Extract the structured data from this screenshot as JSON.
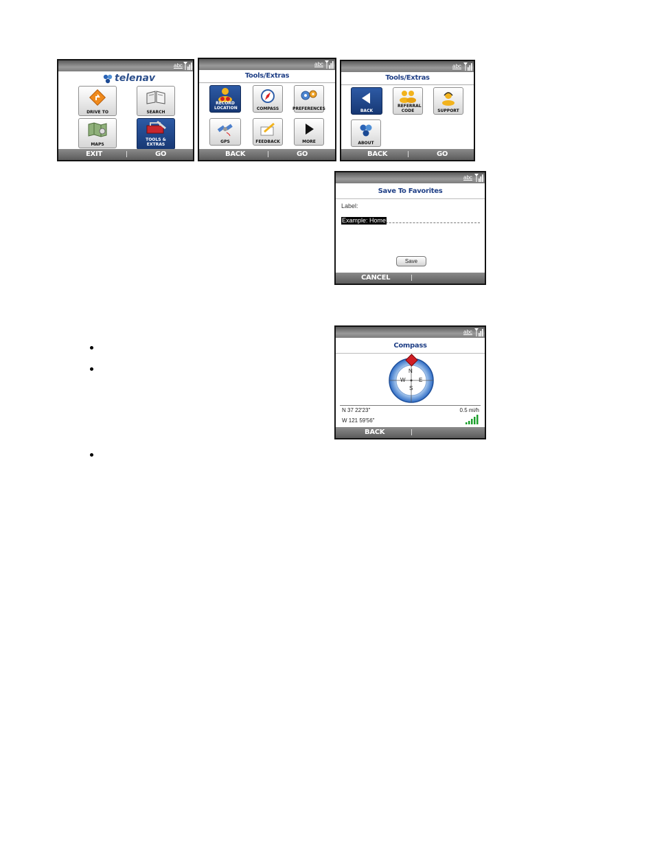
{
  "status": {
    "abc_label": "abc"
  },
  "screen_main": {
    "logo_text": "telenav",
    "items": [
      {
        "label": "DRIVE TO"
      },
      {
        "label": "SEARCH"
      },
      {
        "label": "MAPS"
      },
      {
        "label": "TOOLS & EXTRAS"
      }
    ],
    "left_soft": "EXIT",
    "right_soft": "GO"
  },
  "screen_tools1": {
    "title": "Tools/Extras",
    "items": [
      {
        "label": "RECORD LOCATION"
      },
      {
        "label": "COMPASS"
      },
      {
        "label": "PREFERENCES"
      },
      {
        "label": "GPS"
      },
      {
        "label": "FEEDBACK"
      },
      {
        "label": "MORE"
      }
    ],
    "left_soft": "BACK",
    "right_soft": "GO"
  },
  "screen_tools2": {
    "title": "Tools/Extras",
    "items": [
      {
        "label": "BACK"
      },
      {
        "label": "REFERRAL CODE"
      },
      {
        "label": "SUPPORT"
      },
      {
        "label": "ABOUT"
      }
    ],
    "left_soft": "BACK",
    "right_soft": "GO"
  },
  "screen_favorites": {
    "title": "Save To Favorites",
    "field_label": "Label:",
    "field_value": "Example: Home",
    "save_button": "Save",
    "left_soft": "CANCEL"
  },
  "screen_compass": {
    "title": "Compass",
    "dir_n": "N",
    "dir_e": "E",
    "dir_s": "S",
    "dir_w": "W",
    "latitude": "N 37 22'23\"",
    "longitude": "W 121 59'56\"",
    "speed": "0.5 mi/h",
    "left_soft": "BACK"
  },
  "colors": {
    "title_blue": "#1f3f86",
    "selected_tile": "#1f4a92",
    "gps_green": "#1a9e2a"
  }
}
